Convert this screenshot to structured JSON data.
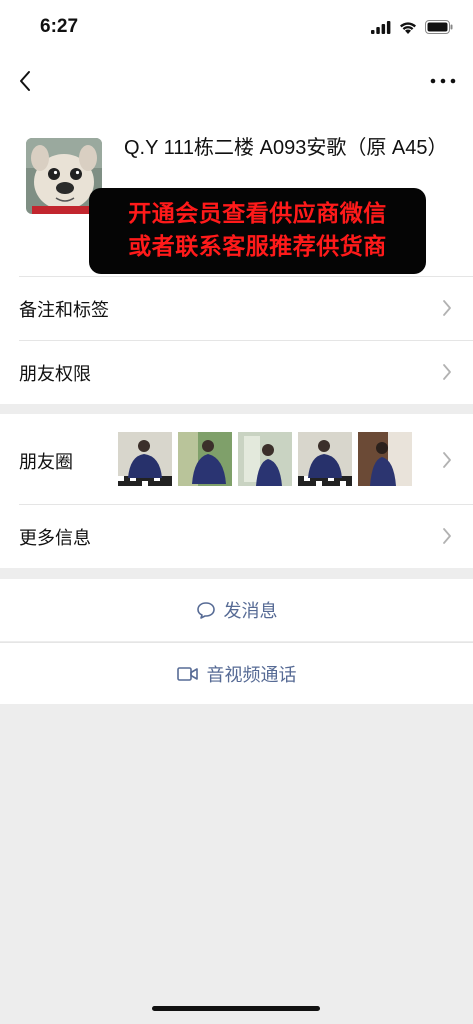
{
  "status_bar": {
    "time": "6:27",
    "icons": [
      "signal-icon",
      "wifi-icon",
      "battery-icon"
    ]
  },
  "nav": {
    "back_icon": "chevron-left-icon",
    "more_icon": "more-dots-icon"
  },
  "profile": {
    "name": "Q.Y 111栋二楼 A093安歌（原 A45）",
    "avatar": "bulldog-photo",
    "promo_line1": "开通会员查看供应商微信",
    "promo_line2": "或者联系客服推荐供货商"
  },
  "rows": {
    "remarks_tags": "备注和标签",
    "friend_permissions": "朋友权限",
    "moments": "朋友圈",
    "more_info": "更多信息"
  },
  "actions": {
    "send_message": "发消息",
    "video_call": "音视频通话"
  },
  "colors": {
    "link": "#576b95",
    "promo_text": "#ff1a1a",
    "promo_bg": "#050505",
    "background": "#ededed"
  }
}
